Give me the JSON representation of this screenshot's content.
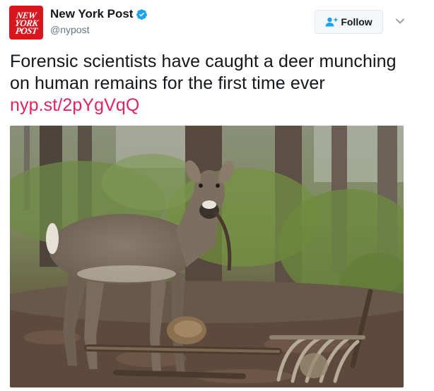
{
  "author": {
    "display_name": "New York Post",
    "handle": "@nypost",
    "avatar_lines": [
      "NEW",
      "YORK",
      "POST"
    ],
    "verified_icon": "verified-badge-icon"
  },
  "follow_button": {
    "label": "Follow",
    "icon": "add-user-icon"
  },
  "more_icon": "chevron-down-icon",
  "tweet": {
    "text": "Forensic scientists have caught a deer munching on human remains for the first time ever ",
    "link_text": "nyp.st/2pYgVqQ"
  },
  "photo": {
    "subject": "deer-photo"
  },
  "colors": {
    "brand_red": "#d7171f",
    "link": "#e0245e",
    "verified_blue": "#1da1f2",
    "text": "#14171a",
    "secondary_text": "#657786"
  }
}
